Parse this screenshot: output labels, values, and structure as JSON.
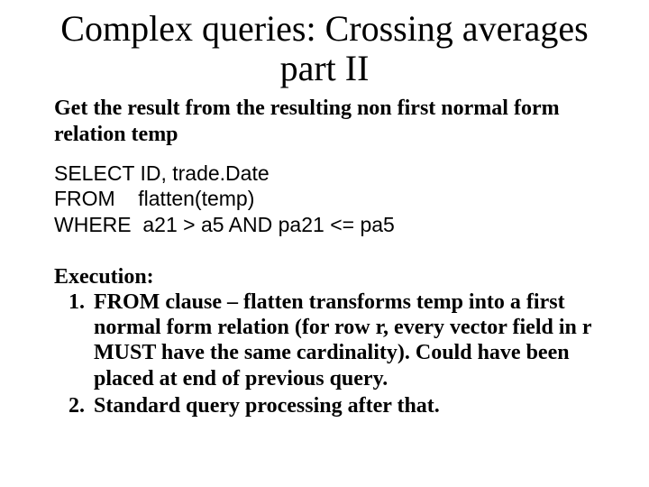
{
  "title": "Complex queries: Crossing averages part II",
  "intro": "Get the result from the resulting non first normal form relation temp",
  "sql": {
    "line1": "SELECT ID, trade.Date",
    "line2": "FROM    flatten(temp)",
    "line3": "WHERE  a21 > a5 AND pa21 <= pa5"
  },
  "execution": {
    "heading": "Execution:",
    "items": [
      "FROM clause – flatten transforms temp into a first normal form relation (for row r, every vector field in r MUST have the same cardinality). Could have been placed at end of previous query.",
      "Standard query processing after that."
    ]
  }
}
